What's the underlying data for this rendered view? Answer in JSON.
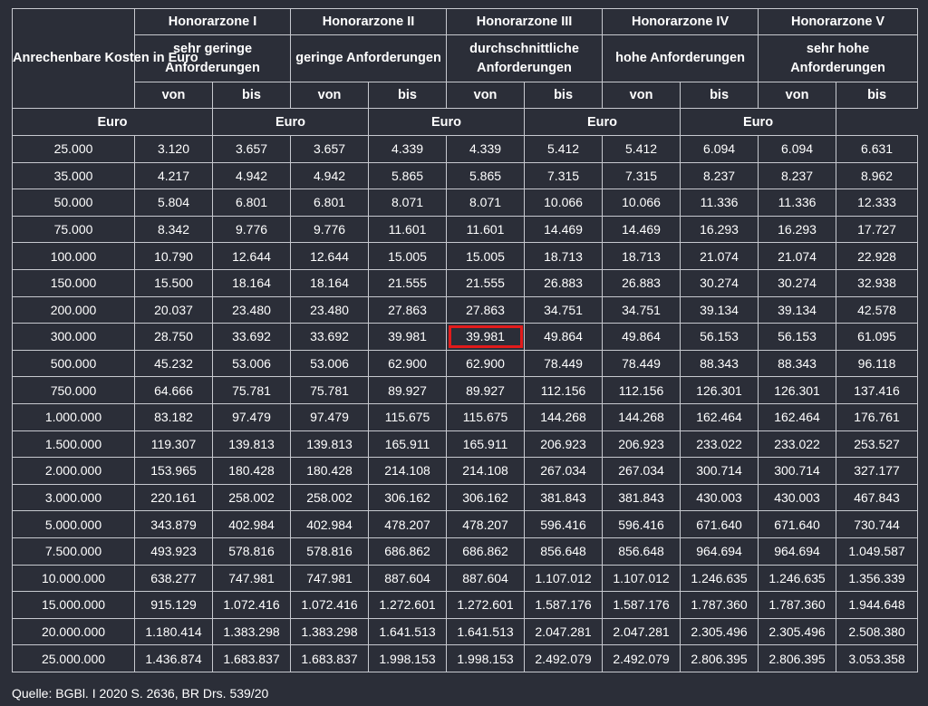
{
  "table": {
    "row_header": "Anrechenbare Kosten in Euro",
    "zones": [
      {
        "name": "Honorarzone I",
        "requirement": "sehr geringe Anforderungen"
      },
      {
        "name": "Honorarzone II",
        "requirement": "geringe Anforderungen"
      },
      {
        "name": "Honorarzone III",
        "requirement": "durchschnittliche Anforderungen"
      },
      {
        "name": "Honorarzone IV",
        "requirement": "hohe Anforderungen"
      },
      {
        "name": "Honorarzone V",
        "requirement": "sehr hohe Anforderungen"
      }
    ],
    "from_label": "von",
    "to_label": "bis",
    "unit_label": "Euro",
    "highlighted_cell": {
      "row": 7,
      "col": 5
    },
    "highlight_color": "#e21b1b",
    "rows": [
      [
        "25.000",
        "3.120",
        "3.657",
        "3.657",
        "4.339",
        "4.339",
        "5.412",
        "5.412",
        "6.094",
        "6.094",
        "6.631"
      ],
      [
        "35.000",
        "4.217",
        "4.942",
        "4.942",
        "5.865",
        "5.865",
        "7.315",
        "7.315",
        "8.237",
        "8.237",
        "8.962"
      ],
      [
        "50.000",
        "5.804",
        "6.801",
        "6.801",
        "8.071",
        "8.071",
        "10.066",
        "10.066",
        "11.336",
        "11.336",
        "12.333"
      ],
      [
        "75.000",
        "8.342",
        "9.776",
        "9.776",
        "11.601",
        "11.601",
        "14.469",
        "14.469",
        "16.293",
        "16.293",
        "17.727"
      ],
      [
        "100.000",
        "10.790",
        "12.644",
        "12.644",
        "15.005",
        "15.005",
        "18.713",
        "18.713",
        "21.074",
        "21.074",
        "22.928"
      ],
      [
        "150.000",
        "15.500",
        "18.164",
        "18.164",
        "21.555",
        "21.555",
        "26.883",
        "26.883",
        "30.274",
        "30.274",
        "32.938"
      ],
      [
        "200.000",
        "20.037",
        "23.480",
        "23.480",
        "27.863",
        "27.863",
        "34.751",
        "34.751",
        "39.134",
        "39.134",
        "42.578"
      ],
      [
        "300.000",
        "28.750",
        "33.692",
        "33.692",
        "39.981",
        "39.981",
        "49.864",
        "49.864",
        "56.153",
        "56.153",
        "61.095"
      ],
      [
        "500.000",
        "45.232",
        "53.006",
        "53.006",
        "62.900",
        "62.900",
        "78.449",
        "78.449",
        "88.343",
        "88.343",
        "96.118"
      ],
      [
        "750.000",
        "64.666",
        "75.781",
        "75.781",
        "89.927",
        "89.927",
        "112.156",
        "112.156",
        "126.301",
        "126.301",
        "137.416"
      ],
      [
        "1.000.000",
        "83.182",
        "97.479",
        "97.479",
        "115.675",
        "115.675",
        "144.268",
        "144.268",
        "162.464",
        "162.464",
        "176.761"
      ],
      [
        "1.500.000",
        "119.307",
        "139.813",
        "139.813",
        "165.911",
        "165.911",
        "206.923",
        "206.923",
        "233.022",
        "233.022",
        "253.527"
      ],
      [
        "2.000.000",
        "153.965",
        "180.428",
        "180.428",
        "214.108",
        "214.108",
        "267.034",
        "267.034",
        "300.714",
        "300.714",
        "327.177"
      ],
      [
        "3.000.000",
        "220.161",
        "258.002",
        "258.002",
        "306.162",
        "306.162",
        "381.843",
        "381.843",
        "430.003",
        "430.003",
        "467.843"
      ],
      [
        "5.000.000",
        "343.879",
        "402.984",
        "402.984",
        "478.207",
        "478.207",
        "596.416",
        "596.416",
        "671.640",
        "671.640",
        "730.744"
      ],
      [
        "7.500.000",
        "493.923",
        "578.816",
        "578.816",
        "686.862",
        "686.862",
        "856.648",
        "856.648",
        "964.694",
        "964.694",
        "1.049.587"
      ],
      [
        "10.000.000",
        "638.277",
        "747.981",
        "747.981",
        "887.604",
        "887.604",
        "1.107.012",
        "1.107.012",
        "1.246.635",
        "1.246.635",
        "1.356.339"
      ],
      [
        "15.000.000",
        "915.129",
        "1.072.416",
        "1.072.416",
        "1.272.601",
        "1.272.601",
        "1.587.176",
        "1.587.176",
        "1.787.360",
        "1.787.360",
        "1.944.648"
      ],
      [
        "20.000.000",
        "1.180.414",
        "1.383.298",
        "1.383.298",
        "1.641.513",
        "1.641.513",
        "2.047.281",
        "2.047.281",
        "2.305.496",
        "2.305.496",
        "2.508.380"
      ],
      [
        "25.000.000",
        "1.436.874",
        "1.683.837",
        "1.683.837",
        "1.998.153",
        "1.998.153",
        "2.492.079",
        "2.492.079",
        "2.806.395",
        "2.806.395",
        "3.053.358"
      ]
    ]
  },
  "source": "Quelle: BGBl. I 2020 S. 2636, BR Drs. 539/20"
}
